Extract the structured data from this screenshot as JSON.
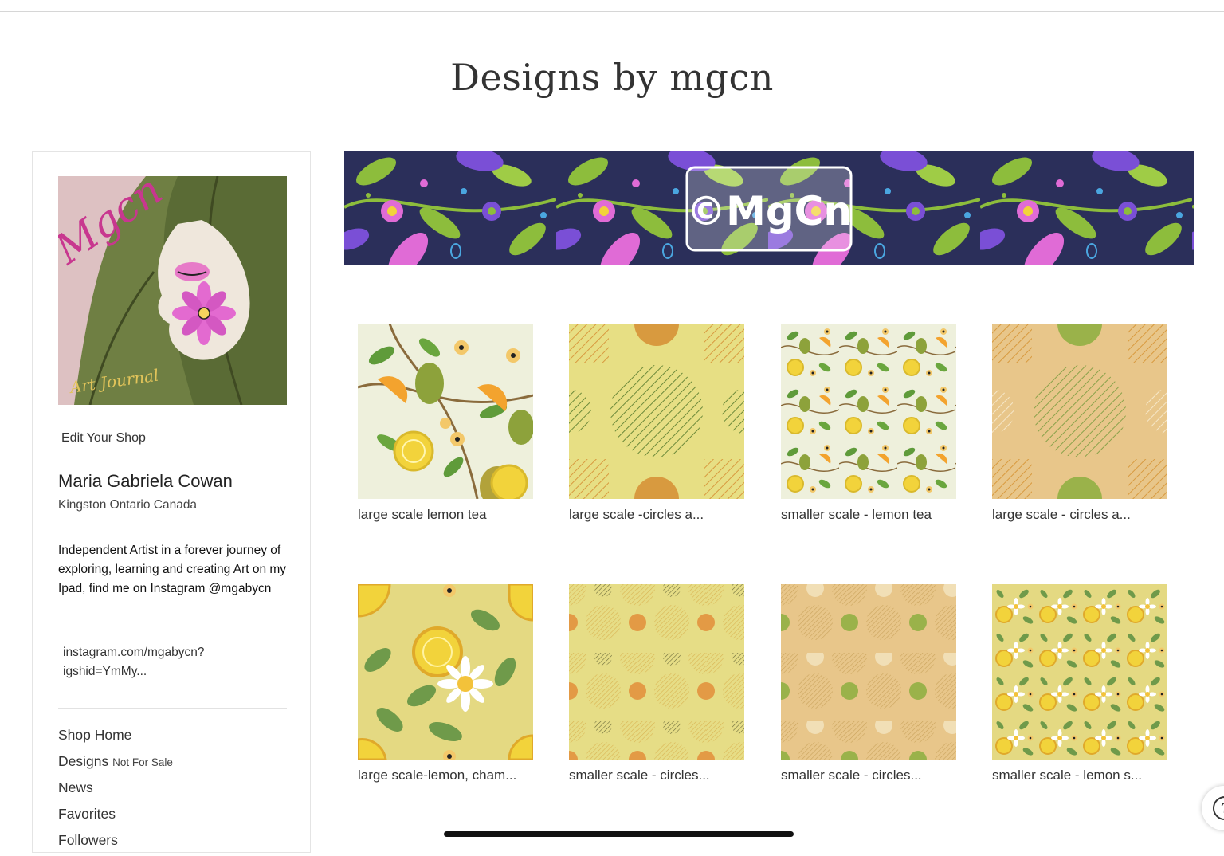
{
  "shop": {
    "title": "Designs by mgcn",
    "banner_text": "©MgCn"
  },
  "sidebar": {
    "avatar_text": "Mgcn",
    "avatar_caption": "Art Journal",
    "edit_shop": "Edit Your Shop",
    "name": "Maria Gabriela Cowan",
    "location": "Kingston Ontario Canada",
    "bio": "Independent Artist in a forever journey of exploring, learning and creating Art on my Ipad, find me on Instagram @mgabycn",
    "link": "instagram.com/mgabycn?igshid=YmMy...",
    "nav": {
      "shop_home": "Shop Home",
      "designs": "Designs",
      "designs_note": "Not For Sale",
      "news": "News",
      "favorites": "Favorites",
      "followers": "Followers"
    }
  },
  "designs": [
    {
      "title": "large scale lemon tea",
      "pattern": "lemon-tea-large"
    },
    {
      "title": "large scale -circles a...",
      "pattern": "circles-large-yellow"
    },
    {
      "title": "smaller scale - lemon tea",
      "pattern": "lemon-tea-small"
    },
    {
      "title": "large scale - circles a...",
      "pattern": "circles-large-orange"
    },
    {
      "title": "large scale-lemon, cham...",
      "pattern": "lemon-chamomile-large"
    },
    {
      "title": "smaller scale - circles...",
      "pattern": "circles-small-yellow"
    },
    {
      "title": "smaller scale - circles...",
      "pattern": "circles-small-orange"
    },
    {
      "title": "smaller scale - lemon s...",
      "pattern": "lemon-small-yellow"
    }
  ],
  "colors": {
    "banner_bg": "#2b2f5a",
    "leaf_green": "#8dbd3c",
    "petal_pink": "#e06bd6",
    "petal_purple": "#7a4fd6",
    "lemon": "#f2d33b",
    "yellow_bg": "#e7df84",
    "orange_bg": "#e8c68a",
    "accent_orange": "#d89a3f",
    "olive": "#9ab24a"
  },
  "help_icon": "help-circle-icon"
}
